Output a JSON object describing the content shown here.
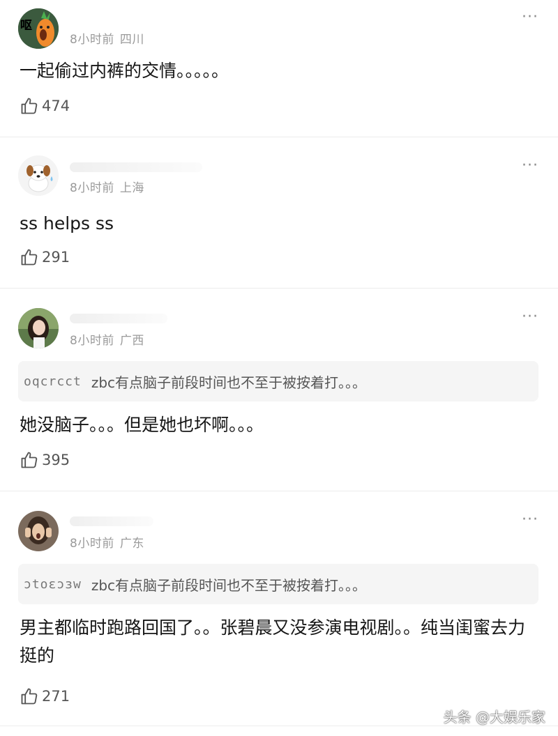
{
  "comments": [
    {
      "avatar_text": "呕",
      "time": "8小时前",
      "location": "四川",
      "text": "一起偷过内裤的交情。。。。。",
      "likes": "474",
      "more": "···"
    },
    {
      "time": "8小时前",
      "location": "上海",
      "text": "ss helps ss",
      "likes": "291",
      "more": "···"
    },
    {
      "time": "8小时前",
      "location": "广西",
      "quote_name": "oqcrcct",
      "quote_text": "zbc有点脑子前段时间也不至于被按着打。。。",
      "text": "她没脑子。。。但是她也坏啊。。。",
      "likes": "395",
      "more": "···"
    },
    {
      "time": "8小时前",
      "location": "广东",
      "quote_name": "ɔtoɛɔɜw",
      "quote_text": "zbc有点脑子前段时间也不至于被按着打。。。",
      "text": "男主都临时跑路回国了。。张碧晨又没参演电视剧。。纯当闺蜜去力挺的",
      "likes": "271",
      "more": "···"
    }
  ],
  "watermark": "头条 @大娱乐家",
  "icons": {
    "like": "thumbs-up-icon",
    "more": "more-dots-icon"
  },
  "colors": {
    "meta": "#9a9a9a",
    "quote_bg": "#f5f5f5",
    "avatar1_bg": "#3d5a3f",
    "avatar1_carrot": "#f08a2c"
  }
}
